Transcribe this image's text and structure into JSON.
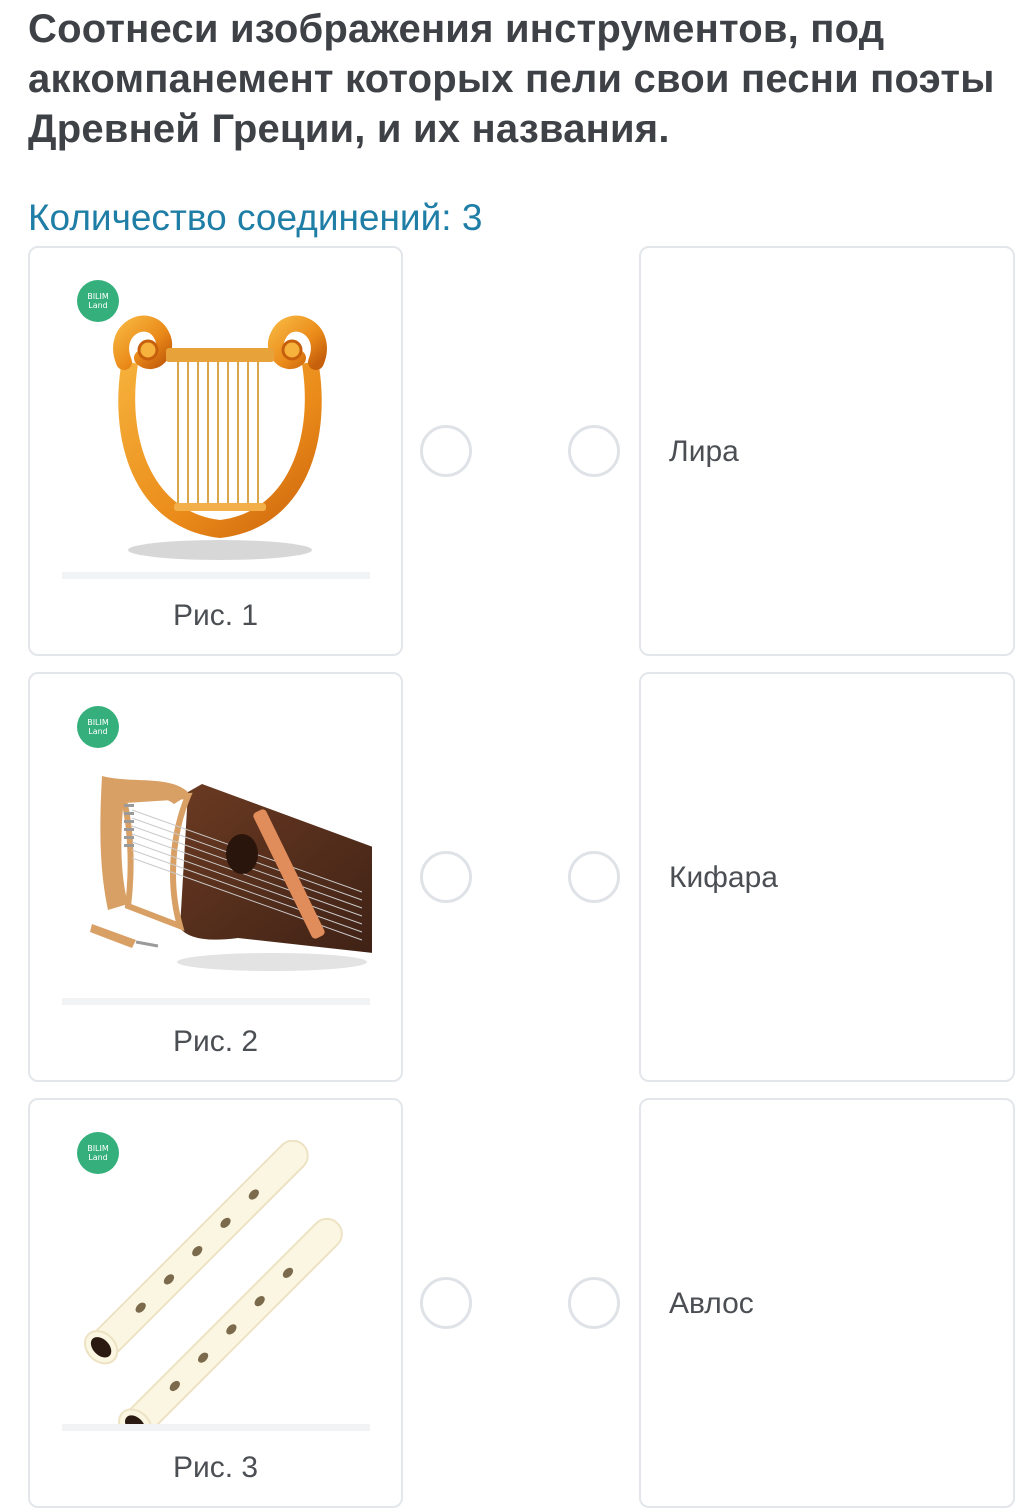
{
  "question": {
    "text": "Соотнеси изображения инструментов, под аккомпанемент которых пели свои песни поэты Древней Греции, и их названия."
  },
  "connections": {
    "label": "Количество соединений: 3"
  },
  "images": [
    {
      "caption": "Рис. 1",
      "icon": "lyre-icon",
      "badge": [
        "BILIM",
        "Land"
      ]
    },
    {
      "caption": "Рис. 2",
      "icon": "kithara-icon",
      "badge": [
        "BILIM",
        "Land"
      ]
    },
    {
      "caption": "Рис. 3",
      "icon": "aulos-icon",
      "badge": [
        "BILIM",
        "Land"
      ]
    }
  ],
  "answers": [
    {
      "label": "Лира"
    },
    {
      "label": "Кифара"
    },
    {
      "label": "Авлос"
    }
  ],
  "colors": {
    "title": "#3e4247",
    "accent": "#1f7ea6",
    "badge": "#35b07c",
    "card_border": "#e3e6ea",
    "connector_border": "#dfe3e7"
  }
}
